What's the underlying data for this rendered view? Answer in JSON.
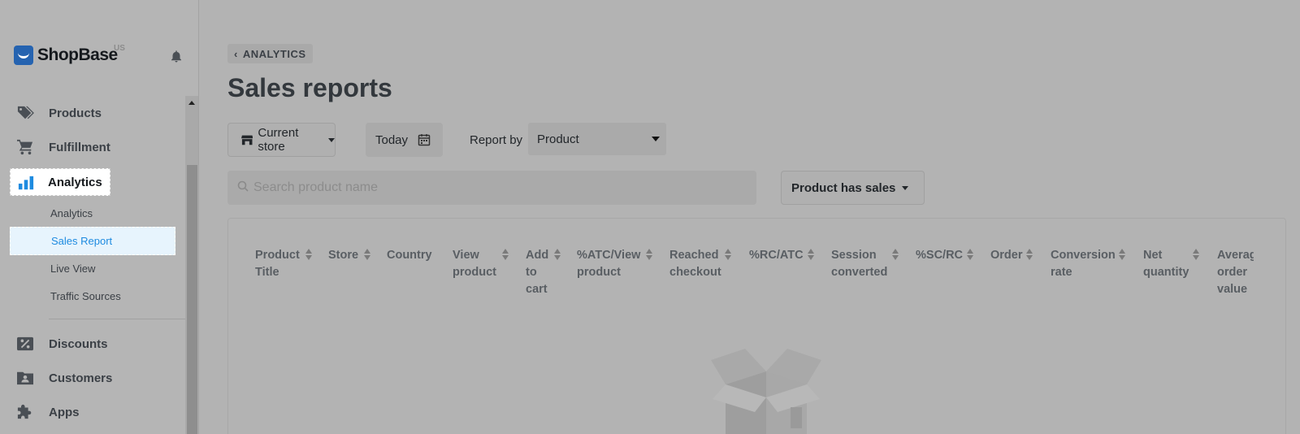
{
  "brand": {
    "name": "ShopBase",
    "region": "US"
  },
  "sidebar": {
    "items": [
      {
        "label": "Products",
        "icon": "tags-icon"
      },
      {
        "label": "Fulfillment",
        "icon": "cart-icon"
      },
      {
        "label": "Analytics",
        "icon": "bar-chart-icon",
        "active": true
      },
      {
        "label": "Discounts",
        "icon": "discount-icon"
      },
      {
        "label": "Customers",
        "icon": "customers-icon"
      },
      {
        "label": "Apps",
        "icon": "puzzle-icon"
      }
    ],
    "sub_items": [
      {
        "label": "Analytics"
      },
      {
        "label": "Sales Report",
        "active": true
      },
      {
        "label": "Live View"
      },
      {
        "label": "Traffic Sources"
      }
    ]
  },
  "main": {
    "breadcrumb": "ANALYTICS",
    "title": "Sales reports",
    "store_button": "Current store",
    "date_button": "Today",
    "report_by_label": "Report by",
    "report_by_value": "Product",
    "search_placeholder": "Search product name",
    "filter_button": "Product has sales",
    "columns": [
      {
        "lines": [
          "Product",
          "Title"
        ]
      },
      {
        "lines": [
          "Store"
        ]
      },
      {
        "lines": [
          "Country"
        ]
      },
      {
        "lines": [
          "View",
          "product"
        ]
      },
      {
        "lines": [
          "Add",
          "to",
          "cart"
        ]
      },
      {
        "lines": [
          "%ATC/View",
          "product"
        ]
      },
      {
        "lines": [
          "Reached",
          "checkout"
        ]
      },
      {
        "lines": [
          "%RC/ATC"
        ]
      },
      {
        "lines": [
          "Session",
          "converted"
        ]
      },
      {
        "lines": [
          "%SC/RC"
        ]
      },
      {
        "lines": [
          "Order"
        ]
      },
      {
        "lines": [
          "Conversion",
          "rate"
        ]
      },
      {
        "lines": [
          "Net",
          "quantity"
        ]
      },
      {
        "lines": [
          "Averag",
          "order",
          "value"
        ]
      }
    ]
  },
  "colors": {
    "accent": "#1e8be0",
    "brand": "#2563b0",
    "overlay": "#b3b3b3"
  }
}
